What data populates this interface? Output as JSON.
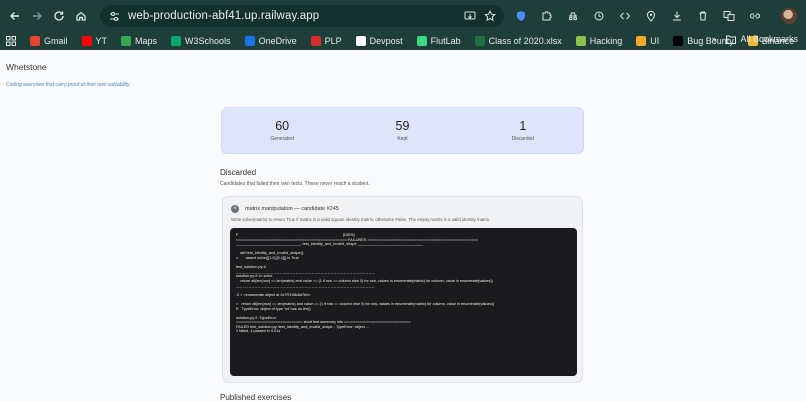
{
  "browser": {
    "url": "web-production-abf41.up.railway.app",
    "bookmarks": [
      "Gmail",
      "YT",
      "Maps",
      "W3Schools",
      "OneDrive",
      "PLP",
      "Devpost",
      "FlutLab",
      "Class of 2020.xlsx",
      "Hacking",
      "UI",
      "Bug Bounty",
      "Binance"
    ],
    "all_bookmarks_label": "All Bookmarks",
    "bookmark_colors": [
      "#ea4335",
      "#ff0000",
      "#34a853",
      "#04aa6d",
      "#1a73e8",
      "#d32f2f",
      "#ffffff",
      "#3ddc84",
      "#1e7145",
      "#8bc34a",
      "#f9a825",
      "#000000",
      "#f3ba2f"
    ]
  },
  "app": {
    "brand": "Whetstone",
    "tagline": "Coding exercises that carry proof of their own solvability",
    "stats": [
      {
        "value": "60",
        "label": "Generated"
      },
      {
        "value": "59",
        "label": "Kept"
      },
      {
        "value": "1",
        "label": "Discarded"
      }
    ],
    "discarded": {
      "title": "Discarded",
      "subtitle": "Candidates that failed their own tests. These never reach a student.",
      "card": {
        "title": "matrix manipulation — candidate #245",
        "description": "Write solve(matrix) to return True if matrix is a valid square identity matrix, otherwise False. The empty matrix is a valid identity matrix.",
        "output": [
          "F                                                                                                   [100%]",
          "================================================== FAILURES ==================================================",
          "_______________________________ test_identity_and_invalid_shape _______________________________",
          "",
          "    def test_identity_and_invalid_shape():",
          ">       assert solve([[1,0],[0,1]]) is True",
          "",
          "test_solution.py:4:",
          "_ _ _ _ _ _ _ _ _ _ _ _ _ _ _ _ _ _ _ _ _ _ _ _ _ _ _ _ _ _ _ _ _ _ _ _ _ _ _ _ _ _ _ _",
          "solution.py:2: in solve",
          "    return all(len(row) == len(matrix) and value == (1 if row == column else 0) for row, values in enumerate(matrix) for column, value in enumerate(values))",
          "_ _ _ _ _ _ _ _ _ _ _ _ _ _ _ _ _ _ _ _ _ _ _ _ _ _ _ _ _ _ _ _ _ _ _ _ _ _ _ _ _ _ _ _",
          "",
          ".0 = <enumerate object at 0x7f7108c6d7b0>",
          "",
          ">   return all(len(row) == len(matrix) and value == (1 if row == column else 0) for row, values in enumerate(matrix) for column, value in enumerate(values))",
          "E   TypeError: object of type 'int' has no len()",
          "",
          "solution.py:2: TypeError",
          "============================== short test summary info ==============================",
          "FAILED test_solution.py::test_identity_and_invalid_shape - TypeError: object ...",
          "1 failed, 1 passed in 0.01s"
        ]
      }
    },
    "next_section_title": "Published exercises"
  }
}
